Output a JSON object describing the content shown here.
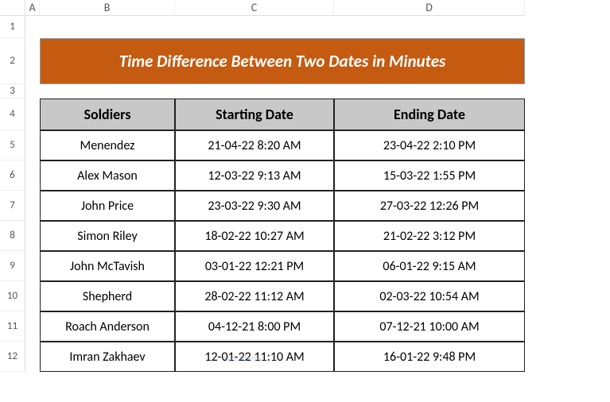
{
  "columns": [
    "A",
    "B",
    "C",
    "D"
  ],
  "rows": [
    "1",
    "2",
    "3",
    "4",
    "5",
    "6",
    "7",
    "8",
    "9",
    "10",
    "11",
    "12"
  ],
  "title": "Time Difference Between Two Dates in Minutes",
  "headers": {
    "b": "Soldiers",
    "c": "Starting Date",
    "d": "Ending Date"
  },
  "table": [
    {
      "soldier": "Menendez",
      "start": "21-04-22 8:20 AM",
      "end": "23-04-22 2:10 PM"
    },
    {
      "soldier": "Alex Mason",
      "start": "12-03-22 9:13 AM",
      "end": "15-03-22 1:55 PM"
    },
    {
      "soldier": "John Price",
      "start": "23-03-22 9:30 AM",
      "end": "27-03-22 12:26 PM"
    },
    {
      "soldier": "Simon Riley",
      "start": "18-02-22 10:27 AM",
      "end": "21-02-22 3:12 PM"
    },
    {
      "soldier": "John McTavish",
      "start": "03-01-22 12:21 PM",
      "end": "06-01-22 9:15 AM"
    },
    {
      "soldier": "Shepherd",
      "start": "28-02-22 11:12 AM",
      "end": "02-03-22 10:54 AM"
    },
    {
      "soldier": "Roach Anderson",
      "start": "04-12-21 8:00 PM",
      "end": "07-12-21 10:00 AM"
    },
    {
      "soldier": "Imran Zakhaev",
      "start": "12-01-22 11:10 AM",
      "end": "16-01-22 9:48 PM"
    }
  ],
  "watermark": "exceldemy",
  "chart_data": {
    "type": "table",
    "title": "Time Difference Between Two Dates in Minutes",
    "columns": [
      "Soldiers",
      "Starting Date",
      "Ending Date"
    ],
    "rows": [
      [
        "Menendez",
        "21-04-22 8:20 AM",
        "23-04-22 2:10 PM"
      ],
      [
        "Alex Mason",
        "12-03-22 9:13 AM",
        "15-03-22 1:55 PM"
      ],
      [
        "John Price",
        "23-03-22 9:30 AM",
        "27-03-22 12:26 PM"
      ],
      [
        "Simon Riley",
        "18-02-22 10:27 AM",
        "21-02-22 3:12 PM"
      ],
      [
        "John McTavish",
        "03-01-22 12:21 PM",
        "06-01-22 9:15 AM"
      ],
      [
        "Shepherd",
        "28-02-22 11:12 AM",
        "02-03-22 10:54 AM"
      ],
      [
        "Roach Anderson",
        "04-12-21 8:00 PM",
        "07-12-21 10:00 AM"
      ],
      [
        "Imran Zakhaev",
        "12-01-22 11:10 AM",
        "16-01-22 9:48 PM"
      ]
    ]
  }
}
